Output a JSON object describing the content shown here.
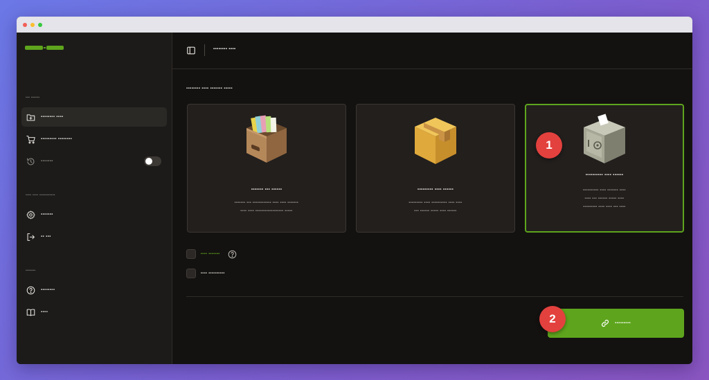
{
  "colors": {
    "accent": "#5ea51d",
    "badge": "#e3413e",
    "background": "#141210",
    "sidebar": "#1d1b19",
    "card": "#221f1d",
    "window_dots": [
      "#f25f58",
      "#fbbe2e",
      "#38c840"
    ]
  },
  "sidebar": {
    "sections": [
      {
        "label": "▪▪▪ ▪▪▪▪▪▪",
        "items": [
          {
            "icon": "folder-plus-icon",
            "label": "▪▪▪▪▪▪▪▪ ▪▪▪▪",
            "active": true
          },
          {
            "icon": "cart-icon",
            "label": "▪▪▪▪▪▪▪▪▪ ▪▪▪▪▪▪▪▪"
          },
          {
            "icon": "history-icon",
            "label": "▪▪▪▪▪▪▪",
            "toggle": false
          }
        ]
      },
      {
        "label": "▪▪▪▪ ▪▪▪▪ ▪▪▪▪▪▪▪▪▪▪▪",
        "items": [
          {
            "icon": "gear-icon",
            "label": "▪▪▪▪▪▪▪"
          },
          {
            "icon": "logout-icon",
            "label": "▪▪ ▪▪▪"
          }
        ]
      },
      {
        "label": "▪▪▪▪▪▪▪",
        "items": [
          {
            "icon": "help-circle-icon",
            "label": "▪▪▪▪▪▪▪▪"
          },
          {
            "icon": "book-icon",
            "label": "▪▪▪▪"
          }
        ]
      }
    ]
  },
  "header": {
    "title": "▪▪▪▪▪▪▪▪ ▪▪▪▪"
  },
  "main": {
    "section_title": "▪▪▪▪▪▪▪▪ ▪▪▪▪ ▪▪▪▪▪▪▪ ▪▪▪▪▪",
    "options": [
      {
        "icon": "file-box-icon",
        "title": "▪▪▪▪▪▪▪ ▪▪▪ ▪▪▪▪▪▪",
        "desc": [
          "▪▪▪▪▪▪▪ ▪▪▪ ▪▪▪▪▪▪▪▪▪▪▪▪ ▪▪▪▪ ▪▪▪▪ ▪▪▪▪▪▪▪",
          "▪▪▪▪ ▪▪▪▪ ▪▪▪▪▪▪▪▪▪▪▪▪▪▪▪▪▪▪ ▪▪▪▪▪"
        ],
        "selected": false
      },
      {
        "icon": "cardboard-box-icon",
        "title": "▪▪▪▪▪▪▪▪▪ ▪▪▪▪ ▪▪▪▪▪▪",
        "desc": [
          "▪▪▪▪▪▪▪▪▪ ▪▪▪▪ ▪▪▪▪▪▪▪▪▪▪ ▪▪▪▪ ▪▪▪▪",
          "▪▪▪ ▪▪▪▪▪▪ ▪▪▪▪▪ ▪▪▪▪ ▪▪▪▪▪▪"
        ],
        "selected": false
      },
      {
        "icon": "safe-box-icon",
        "title": "▪▪▪▪▪▪▪▪▪▪ ▪▪▪▪ ▪▪▪▪▪▪",
        "desc": [
          "▪▪▪▪▪▪▪▪▪▪ ▪▪▪▪ ▪▪▪▪▪▪▪ ▪▪▪▪",
          "▪▪▪▪ ▪▪▪ ▪▪▪▪▪▪ ▪▪▪▪▪ ▪▪▪▪",
          "▪▪▪▪▪▪▪▪▪ ▪▪▪▪ ▪▪▪▪ ▪▪▪ ▪▪▪▪"
        ],
        "selected": true
      }
    ],
    "checkboxes": [
      {
        "label": "▪▪▪▪ ▪▪▪▪▪▪▪",
        "highlight": true,
        "checked": false
      },
      {
        "label": "▪▪▪▪ ▪▪▪▪▪▪▪▪▪▪",
        "highlight": false,
        "checked": false
      }
    ],
    "primary_button": {
      "label": "▪▪▪▪▪▪▪▪▪",
      "icon": "link-icon"
    }
  },
  "annotations": [
    "1",
    "2"
  ]
}
